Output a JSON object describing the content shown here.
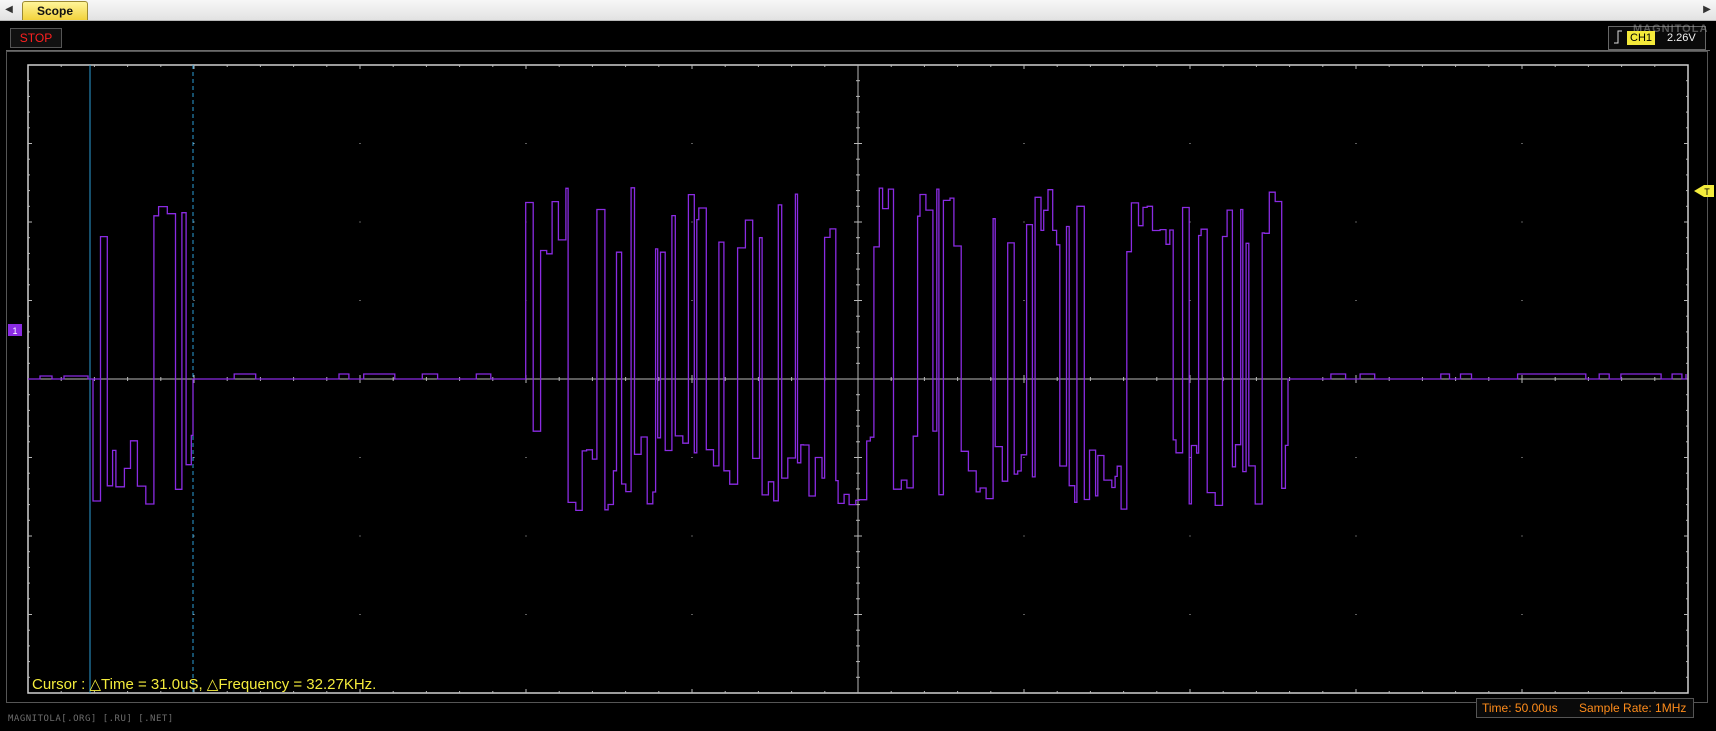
{
  "tabbar": {
    "tab_label": "Scope",
    "left_arrow": "◀",
    "right_arrow": "▶"
  },
  "toolbar": {
    "stop_label": "STOP",
    "channel_label": "CH1",
    "trigger_level": "2.26V",
    "brand_logo": "MAGNITOLA"
  },
  "markers": {
    "ground_marker": "1",
    "trigger_marker": "T"
  },
  "readout": {
    "cursor_text": "Cursor : △Time = 31.0uS, △Frequency = 32.27KHz."
  },
  "status": {
    "time_div": "Time: 50.00us",
    "sample_rate": "Sample Rate: 1MHz"
  },
  "watermark": "MAGNITOLA[.ORG] [.RU] [.NET]",
  "colors": {
    "background": "#000000",
    "grid": "#b8b8b8",
    "trace": "#8a2be2",
    "cursor": "#2b9ed6",
    "readout": "#f4ec3c",
    "status_text": "#ff8c1a",
    "stop_text": "#ff2020"
  },
  "chart_data": {
    "type": "line",
    "grid": true,
    "divisions": {
      "x": 10,
      "y": 8
    },
    "series": [
      {
        "values": [
          0,
          0,
          0,
          0,
          0,
          0,
          0,
          0,
          0,
          0,
          0,
          0,
          0,
          0,
          0,
          0,
          0,
          0,
          0,
          0,
          0,
          0,
          0,
          0,
          0,
          0,
          0,
          0,
          0,
          0,
          0,
          0,
          0,
          0,
          0,
          0,
          0,
          0,
          0,
          0,
          0,
          0,
          0,
          0,
          0,
          0,
          0,
          0,
          0,
          0,
          0,
          0,
          0,
          0,
          0,
          0,
          0,
          0,
          0,
          0,
          0,
          0,
          0,
          0,
          0,
          0,
          0,
          0,
          0,
          0,
          0,
          0,
          0,
          0,
          0,
          0,
          0,
          0,
          0,
          0,
          0,
          0,
          0,
          0,
          0,
          0,
          0,
          0,
          0,
          0
        ]
      }
    ]
  }
}
